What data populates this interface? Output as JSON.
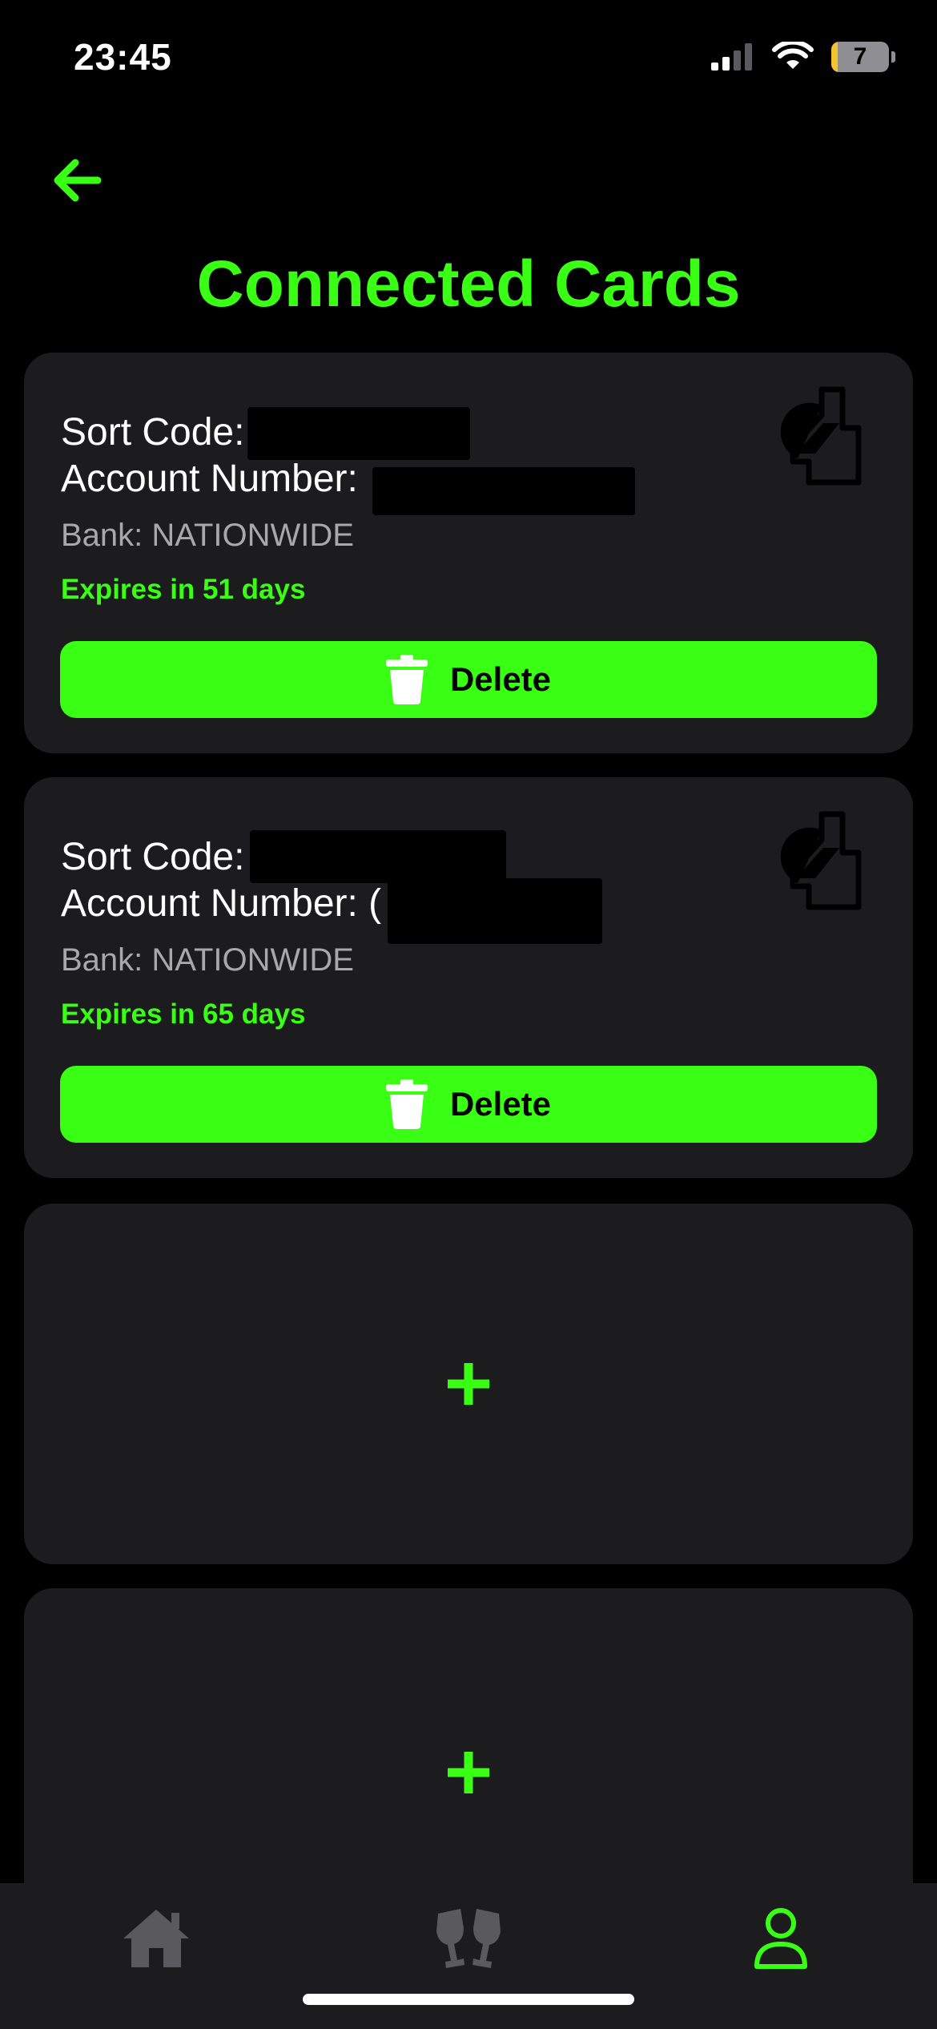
{
  "status_bar": {
    "time": "23:45",
    "battery_level": "7",
    "battery_fraction": 0.07,
    "signal_bars_active": 2,
    "icons": [
      "cellular-signal-icon",
      "wifi-icon",
      "battery-icon"
    ]
  },
  "header": {
    "back_icon": "arrow-left-icon",
    "title": "Connected Cards"
  },
  "cards": [
    {
      "sort_code_label": "Sort Code:",
      "account_number_label": "Account Number:",
      "bank": "Bank: NATIONWIDE",
      "expiry": "Expires in 51 days",
      "delete_label": "Delete",
      "logo_icon": "nationwide-bank-logo-icon"
    },
    {
      "sort_code_label": "Sort Code:",
      "account_number_label": "Account Number: (",
      "bank": "Bank: NATIONWIDE",
      "expiry": "Expires in 65 days",
      "delete_label": "Delete",
      "logo_icon": "nationwide-bank-logo-icon"
    }
  ],
  "empty_slots": [
    {
      "icon": "plus-icon"
    },
    {
      "icon": "plus-icon"
    }
  ],
  "tab_bar": {
    "tabs": [
      {
        "id": "home",
        "icon": "home-icon",
        "active": false
      },
      {
        "id": "social",
        "icon": "cheers-glasses-icon",
        "active": false
      },
      {
        "id": "profile",
        "icon": "user-icon",
        "active": true
      }
    ]
  },
  "colors": {
    "accent": "#39ff14",
    "background": "#000000",
    "card": "#1c1c1e",
    "inactive_icon": "#5a5a5e",
    "secondary_text": "#a8a8a8"
  }
}
